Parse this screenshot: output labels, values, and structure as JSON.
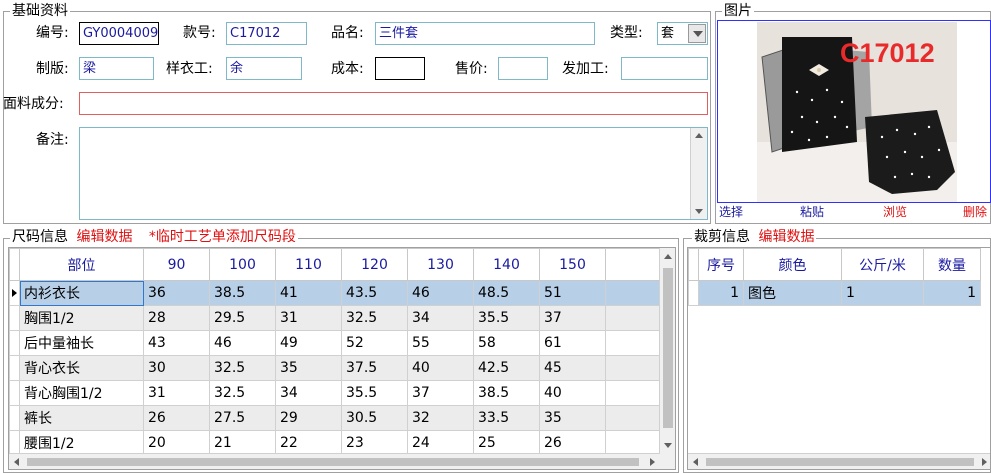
{
  "basic": {
    "title": "基础资料",
    "code_label": "编号:",
    "code_value": "GY0004009",
    "style_label": "款号:",
    "style_value": "C17012",
    "name_label": "品名:",
    "name_value": "三件套",
    "type_label": "类型:",
    "type_value": "套",
    "pattern_label": "制版:",
    "pattern_value": "梁",
    "sample_label": "样衣工:",
    "sample_value": "余",
    "cost_label": "成本:",
    "cost_value": "",
    "price_label": "售价:",
    "price_value": "",
    "process_label": "发加工:",
    "process_value": "",
    "fabric_label": "面料成分:",
    "fabric_value": "",
    "remark_label": "备注:",
    "remark_value": ""
  },
  "picture": {
    "title": "图片",
    "overlay_text": "C17012",
    "actions": [
      "选择",
      "粘贴",
      "浏览",
      "删除"
    ]
  },
  "size": {
    "title": "尺码信息",
    "edit_link": "编辑数据",
    "hint": "*临时工艺单添加尺码段",
    "columns": [
      "部位",
      "90",
      "100",
      "110",
      "120",
      "130",
      "140",
      "150"
    ],
    "rows": [
      [
        "内衫衣长",
        "36",
        "38.5",
        "41",
        "43.5",
        "46",
        "48.5",
        "51"
      ],
      [
        "胸围1/2",
        "28",
        "29.5",
        "31",
        "32.5",
        "34",
        "35.5",
        "37"
      ],
      [
        "后中量袖长",
        "43",
        "46",
        "49",
        "52",
        "55",
        "58",
        "61"
      ],
      [
        "背心衣长",
        "30",
        "32.5",
        "35",
        "37.5",
        "40",
        "42.5",
        "45"
      ],
      [
        "背心胸围1/2",
        "31",
        "32.5",
        "34",
        "35.5",
        "37",
        "38.5",
        "40"
      ],
      [
        "裤长",
        "26",
        "27.5",
        "29",
        "30.5",
        "32",
        "33.5",
        "35"
      ],
      [
        "腰围1/2",
        "20",
        "21",
        "22",
        "23",
        "24",
        "25",
        "26"
      ]
    ]
  },
  "cut": {
    "title": "裁剪信息",
    "edit_link": "编辑数据",
    "columns": [
      "序号",
      "颜色",
      "公斤/米",
      "数量"
    ],
    "rows": [
      [
        "1",
        "图色",
        "1",
        "1"
      ]
    ]
  },
  "colors": {
    "accent_blue": "#1a1aa0",
    "link_red": "#e01010",
    "selected_row": "#b8cfe8",
    "alt_row": "#ececec"
  }
}
